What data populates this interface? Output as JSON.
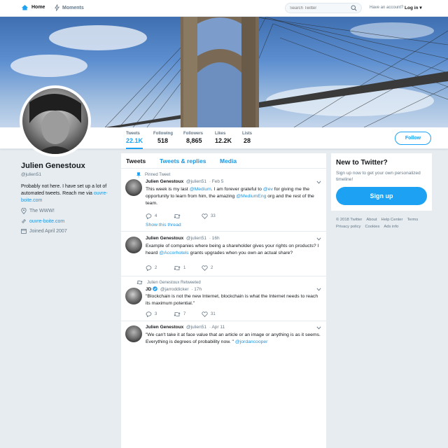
{
  "nav": {
    "home": "Home",
    "moments": "Moments",
    "search_placeholder": "Search Twitter",
    "account_prompt": "Have an account?",
    "login": "Log in"
  },
  "profile": {
    "name": "Julien Genestoux",
    "handle": "@julien51",
    "bio": "Probably not here. I have set up a lot of automated tweets. Reach me via ",
    "bio_link": "ouvre-boite.com",
    "location": "The WWW!",
    "website": "ouvre-boite.com",
    "joined": "Joined April 2007"
  },
  "stats": [
    {
      "label": "Tweets",
      "value": "22.1K"
    },
    {
      "label": "Following",
      "value": "518"
    },
    {
      "label": "Followers",
      "value": "8,865"
    },
    {
      "label": "Likes",
      "value": "12.2K"
    },
    {
      "label": "Lists",
      "value": "28"
    }
  ],
  "follow_label": "Follow",
  "tabs": [
    "Tweets",
    "Tweets & replies",
    "Media"
  ],
  "tweets": [
    {
      "context": "Pinned Tweet",
      "name": "Julien Genestoux",
      "handle": "@julien51",
      "time": "· Feb 5",
      "text_1": "This week is my last ",
      "link_1": "@Medium",
      "text_2": ". I am forever grateful to ",
      "link_2": "@ev",
      "text_3": " for giving me the opportunity to learn from him, the amazing ",
      "link_3": "@MediumEng",
      "text_4": " org and the rest of the team.",
      "replies": "4",
      "retweets": "",
      "likes": "33",
      "show_thread": "Show this thread"
    },
    {
      "name": "Julien Genestoux",
      "handle": "@julien51",
      "time": "· 16h",
      "text_1": "Example of companies where being a shareholder gives your rights on products? I heard ",
      "link_1": "@Accorhotels",
      "text_2": " grants upgrades when you own an actual share?",
      "replies": "2",
      "retweets": "1",
      "likes": "2"
    },
    {
      "context": "Julien Genestoux Retweeted",
      "name": "JD",
      "handle": "@jarroddicker",
      "time": "· 17h",
      "text_1": "\"Blockchain is not the new Internet, blockchain is what the Internet needs to reach its maximum potential.\"",
      "replies": "3",
      "retweets": "7",
      "likes": "31"
    },
    {
      "name": "Julien Genestoux",
      "handle": "@julien51",
      "time": "· Apr 11",
      "text_1": "\"We can't take it at face value that an article or an image or anything is as it seems. Everything is degrees of probability now. \" ",
      "link_1": "@jordancooper"
    }
  ],
  "sidebar": {
    "title": "New to Twitter?",
    "subtitle": "Sign up now to get your own personalized timeline!",
    "signup": "Sign up"
  },
  "footer": [
    "© 2018 Twitter",
    "About",
    "Help Center",
    "Terms",
    "Privacy policy",
    "Cookies",
    "Ads info"
  ],
  "colors": {
    "accent": "#1da1f2",
    "link": "#1b95e0",
    "background": "#e6ecf0"
  }
}
